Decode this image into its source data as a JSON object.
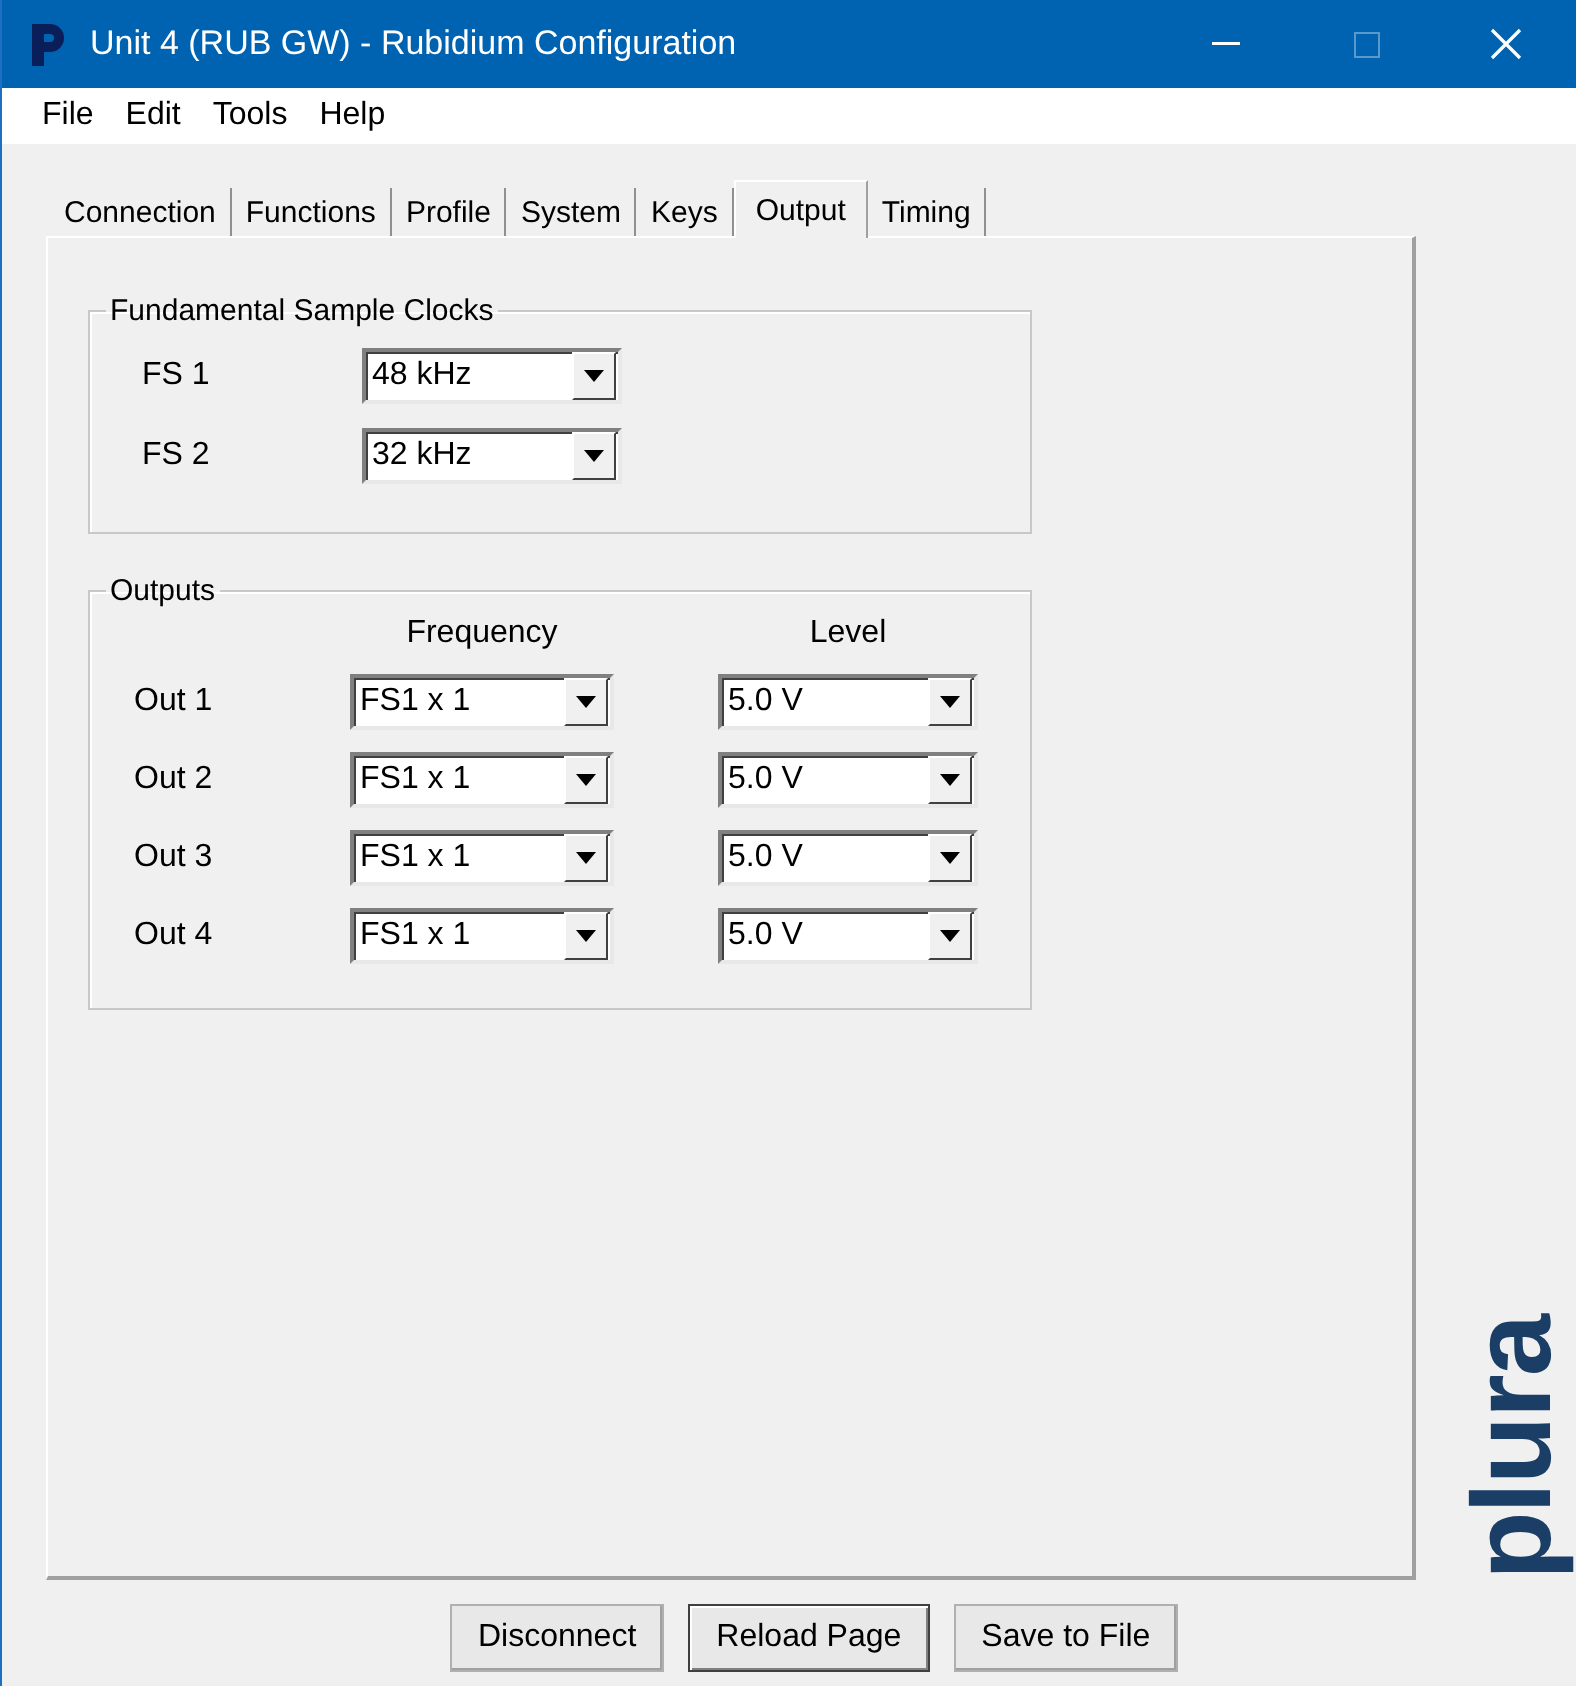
{
  "window": {
    "title": "Unit 4 (RUB GW) - Rubidium Configuration",
    "maximize_disabled": true
  },
  "menu": [
    "File",
    "Edit",
    "Tools",
    "Help"
  ],
  "tabs": [
    {
      "label": "Connection",
      "selected": false
    },
    {
      "label": "Functions",
      "selected": false
    },
    {
      "label": "Profile",
      "selected": false
    },
    {
      "label": "System",
      "selected": false
    },
    {
      "label": "Keys",
      "selected": false
    },
    {
      "label": "Output",
      "selected": true
    },
    {
      "label": "Timing",
      "selected": false
    }
  ],
  "clocks": {
    "title": "Fundamental Sample Clocks",
    "rows": [
      {
        "label": "FS 1",
        "value": "48 kHz"
      },
      {
        "label": "FS 2",
        "value": "32 kHz"
      }
    ]
  },
  "outputs": {
    "title": "Outputs",
    "columns": [
      "Frequency",
      "Level"
    ],
    "rows": [
      {
        "label": "Out 1",
        "frequency": "FS1 x 1",
        "level_value": "5.0 V"
      },
      {
        "label": "Out 2",
        "frequency": "FS1 x 1",
        "level_value": "5.0 V"
      },
      {
        "label": "Out 3",
        "frequency": "FS1 x 1",
        "level_value": "5.0 V"
      },
      {
        "label": "Out 4",
        "frequency": "FS1 x 1",
        "level_value": "5.0 V"
      }
    ]
  },
  "logo": "plura",
  "buttons": [
    {
      "label": "Disconnect",
      "default": false
    },
    {
      "label": "Reload Page",
      "default": true
    },
    {
      "label": "Save to File",
      "default": false
    }
  ]
}
